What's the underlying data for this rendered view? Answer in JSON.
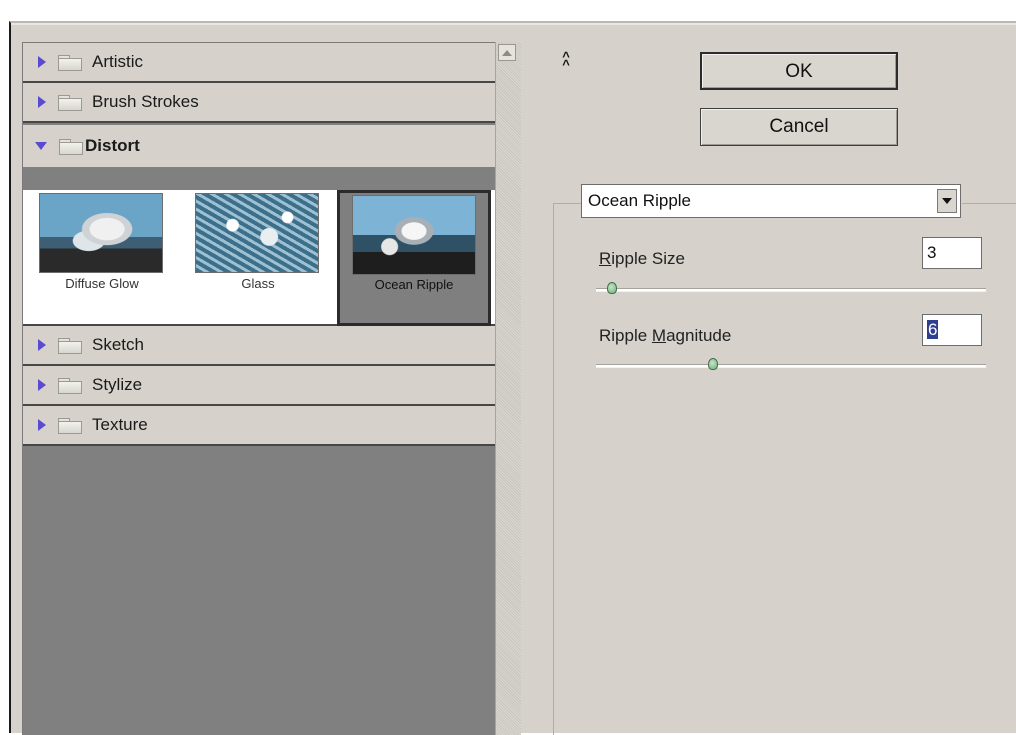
{
  "filter_browser": {
    "categories": [
      {
        "label": "Artistic",
        "expanded": false
      },
      {
        "label": "Brush Strokes",
        "expanded": false
      },
      {
        "label": "Distort",
        "expanded": true
      },
      {
        "label": "Sketch",
        "expanded": false
      },
      {
        "label": "Stylize",
        "expanded": false
      },
      {
        "label": "Texture",
        "expanded": false
      }
    ],
    "distort_filters": [
      {
        "label": "Diffuse Glow",
        "selected": false
      },
      {
        "label": "Glass",
        "selected": false
      },
      {
        "label": "Ocean Ripple",
        "selected": true
      }
    ]
  },
  "buttons": {
    "ok": "OK",
    "cancel": "Cancel",
    "collapse_icon": "double-chevron-up"
  },
  "settings": {
    "filter_select": "Ocean Ripple",
    "ripple_size": {
      "label_prefix": "",
      "label_mnemonic": "R",
      "label_rest": "ipple Size",
      "value": "3",
      "slider_level": 0.04
    },
    "ripple_magnitude": {
      "label_prefix": "Ripple ",
      "label_mnemonic": "M",
      "label_rest": "agnitude",
      "value": "6",
      "slider_level": 0.3
    }
  },
  "colors": {
    "panel_bg": "#d6d2cb",
    "list_bg": "#808080",
    "expand_arrow": "#5a4ad0",
    "slider_handle": "#6fae7c"
  }
}
